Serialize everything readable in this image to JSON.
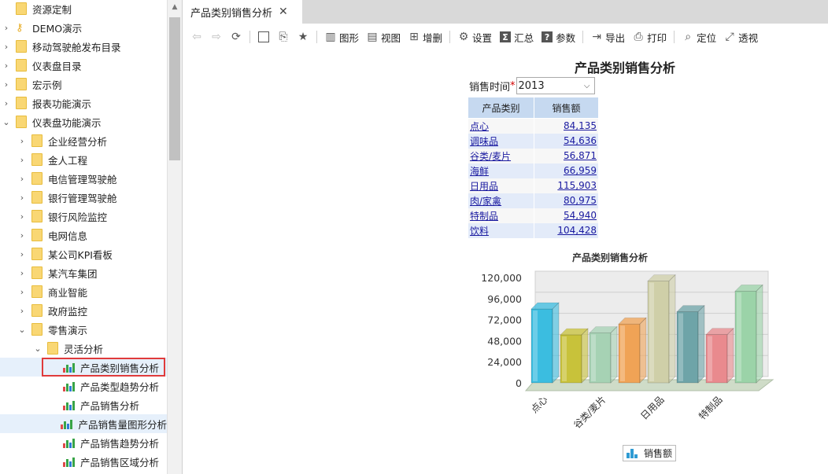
{
  "tree": {
    "items": [
      {
        "label": "资源定制",
        "type": "folder",
        "chev": "",
        "indent": 0
      },
      {
        "label": "DEMO演示",
        "type": "key",
        "chev": "›",
        "indent": 0
      },
      {
        "label": "移动驾驶舱发布目录",
        "type": "folder",
        "chev": "›",
        "indent": 0
      },
      {
        "label": "仪表盘目录",
        "type": "folder",
        "chev": "›",
        "indent": 0
      },
      {
        "label": "宏示例",
        "type": "folder",
        "chev": "›",
        "indent": 0
      },
      {
        "label": "报表功能演示",
        "type": "folder",
        "chev": "›",
        "indent": 0
      },
      {
        "label": "仪表盘功能演示",
        "type": "folder",
        "chev": "⌄",
        "indent": 0
      },
      {
        "label": "企业经营分析",
        "type": "folder",
        "chev": "›",
        "indent": 1
      },
      {
        "label": "金人工程",
        "type": "folder",
        "chev": "›",
        "indent": 1
      },
      {
        "label": "电信管理驾驶舱",
        "type": "folder",
        "chev": "›",
        "indent": 1
      },
      {
        "label": "银行管理驾驶舱",
        "type": "folder",
        "chev": "›",
        "indent": 1
      },
      {
        "label": "银行风险监控",
        "type": "folder",
        "chev": "›",
        "indent": 1
      },
      {
        "label": "电网信息",
        "type": "folder",
        "chev": "›",
        "indent": 1
      },
      {
        "label": "某公司KPI看板",
        "type": "folder",
        "chev": "›",
        "indent": 1
      },
      {
        "label": "某汽车集团",
        "type": "folder",
        "chev": "›",
        "indent": 1
      },
      {
        "label": "商业智能",
        "type": "folder",
        "chev": "›",
        "indent": 1
      },
      {
        "label": "政府监控",
        "type": "folder",
        "chev": "›",
        "indent": 1
      },
      {
        "label": "零售演示",
        "type": "folder",
        "chev": "⌄",
        "indent": 1
      },
      {
        "label": "灵活分析",
        "type": "folder",
        "chev": "⌄",
        "indent": 2
      },
      {
        "label": "产品类别销售分析",
        "type": "report",
        "chev": "",
        "indent": 3,
        "state": "selected"
      },
      {
        "label": "产品类型趋势分析",
        "type": "report",
        "chev": "",
        "indent": 3
      },
      {
        "label": "产品销售分析",
        "type": "report",
        "chev": "",
        "indent": 3
      },
      {
        "label": "产品销售量图形分析",
        "type": "report",
        "chev": "",
        "indent": 3,
        "state": "hover"
      },
      {
        "label": "产品销售趋势分析",
        "type": "report",
        "chev": "",
        "indent": 3
      },
      {
        "label": "产品销售区域分析",
        "type": "report",
        "chev": "",
        "indent": 3
      }
    ]
  },
  "tab": {
    "label": "产品类别销售分析",
    "close": "✕"
  },
  "toolbar": {
    "chart": "图形",
    "view": "视图",
    "add_delete": "增删",
    "settings": "设置",
    "summary": "汇总",
    "params": "参数",
    "export": "导出",
    "print": "打印",
    "locate": "定位",
    "pivot": "透视"
  },
  "report": {
    "title": "产品类别销售分析",
    "filter_label": "销售时间",
    "filter_required": "*",
    "filter_value": "2013",
    "columns": [
      "产品类别",
      "销售额"
    ],
    "rows": [
      {
        "category": "点心",
        "sales": "84,135"
      },
      {
        "category": "调味品",
        "sales": "54,636"
      },
      {
        "category": "谷类/麦片",
        "sales": "56,871"
      },
      {
        "category": "海鲜",
        "sales": "66,959"
      },
      {
        "category": "日用品",
        "sales": "115,903"
      },
      {
        "category": "肉/家禽",
        "sales": "80,975"
      },
      {
        "category": "特制品",
        "sales": "54,940"
      },
      {
        "category": "饮料",
        "sales": "104,428"
      }
    ]
  },
  "chart_data": {
    "type": "bar",
    "title": "产品类别销售分析",
    "categories": [
      "点心",
      "调味品",
      "谷类/麦片",
      "海鲜",
      "日用品",
      "肉/家禽",
      "特制品",
      "饮料"
    ],
    "x_tick_labels": [
      "点心",
      "谷类/麦片",
      "日用品",
      "特制品"
    ],
    "series": [
      {
        "name": "销售额",
        "values": [
          84135,
          54636,
          56871,
          66959,
          115903,
          80975,
          54940,
          104428
        ]
      }
    ],
    "colors": [
      "#3bbde0",
      "#c8c23a",
      "#a6d2b4",
      "#f0a356",
      "#cfcfa8",
      "#6ea4a8",
      "#e98a8e",
      "#9bd3a8"
    ],
    "yticks": [
      "0",
      "24,000",
      "48,000",
      "72,000",
      "96,000",
      "120,000"
    ],
    "ylim": [
      0,
      120000
    ],
    "legend": "bottom"
  }
}
